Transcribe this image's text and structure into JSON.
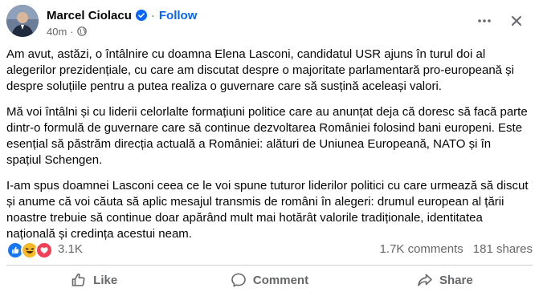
{
  "author": {
    "name": "Marcel Ciolacu",
    "follow_label": "Follow",
    "separator": "·",
    "time": "40m",
    "meta_separator": "·"
  },
  "post": {
    "paragraphs": [
      "Am avut, astăzi, o întâlnire cu doamna Elena Lasconi, candidatul USR ajuns în turul doi al alegerilor prezidențiale, cu care am discutat despre o majoritate parlamentară pro-europeană și despre soluțiile pentru a putea realiza o guvernare care să susțină aceleași valori.",
      "Mă voi întâlni și cu liderii celorlalte formațiuni politice care au anunțat deja că doresc să facă parte dintr-o formulă de guvernare care să continue dezvoltarea României folosind bani europeni. Este esențial să păstrăm direcția actuală a României: alături de Uniunea Europeană, NATO și în spațiul Schengen.",
      "I-am spus doamnei Lasconi ceea ce le voi spune tuturor liderilor politici cu care urmează să discut și anume că voi căuta să aplic mesajul transmis de români în alegeri: drumul european al țării noastre trebuie să continue doar apărând mult mai hotărât valorile tradiționale, identitatea națională și credința acestui neam."
    ]
  },
  "stats": {
    "reaction_count": "3.1K",
    "comments": "1.7K comments",
    "shares": "181 shares"
  },
  "actions": {
    "like": "Like",
    "comment": "Comment",
    "share": "Share"
  },
  "colors": {
    "link_blue": "#0866ff",
    "like_blue": "#1877f2",
    "haha_yellow": "#f7b928",
    "love_red": "#f33e58",
    "secondary_text": "#65676b"
  },
  "icons": {
    "verified": "verified-badge-icon",
    "privacy": "globe-icon",
    "more": "more-options-icon",
    "close": "close-icon",
    "like_reaction": "like-reaction-icon",
    "haha_reaction": "haha-reaction-icon",
    "love_reaction": "love-reaction-icon",
    "like_action": "thumbs-up-icon",
    "comment_action": "comment-bubble-icon",
    "share_action": "share-arrow-icon"
  }
}
